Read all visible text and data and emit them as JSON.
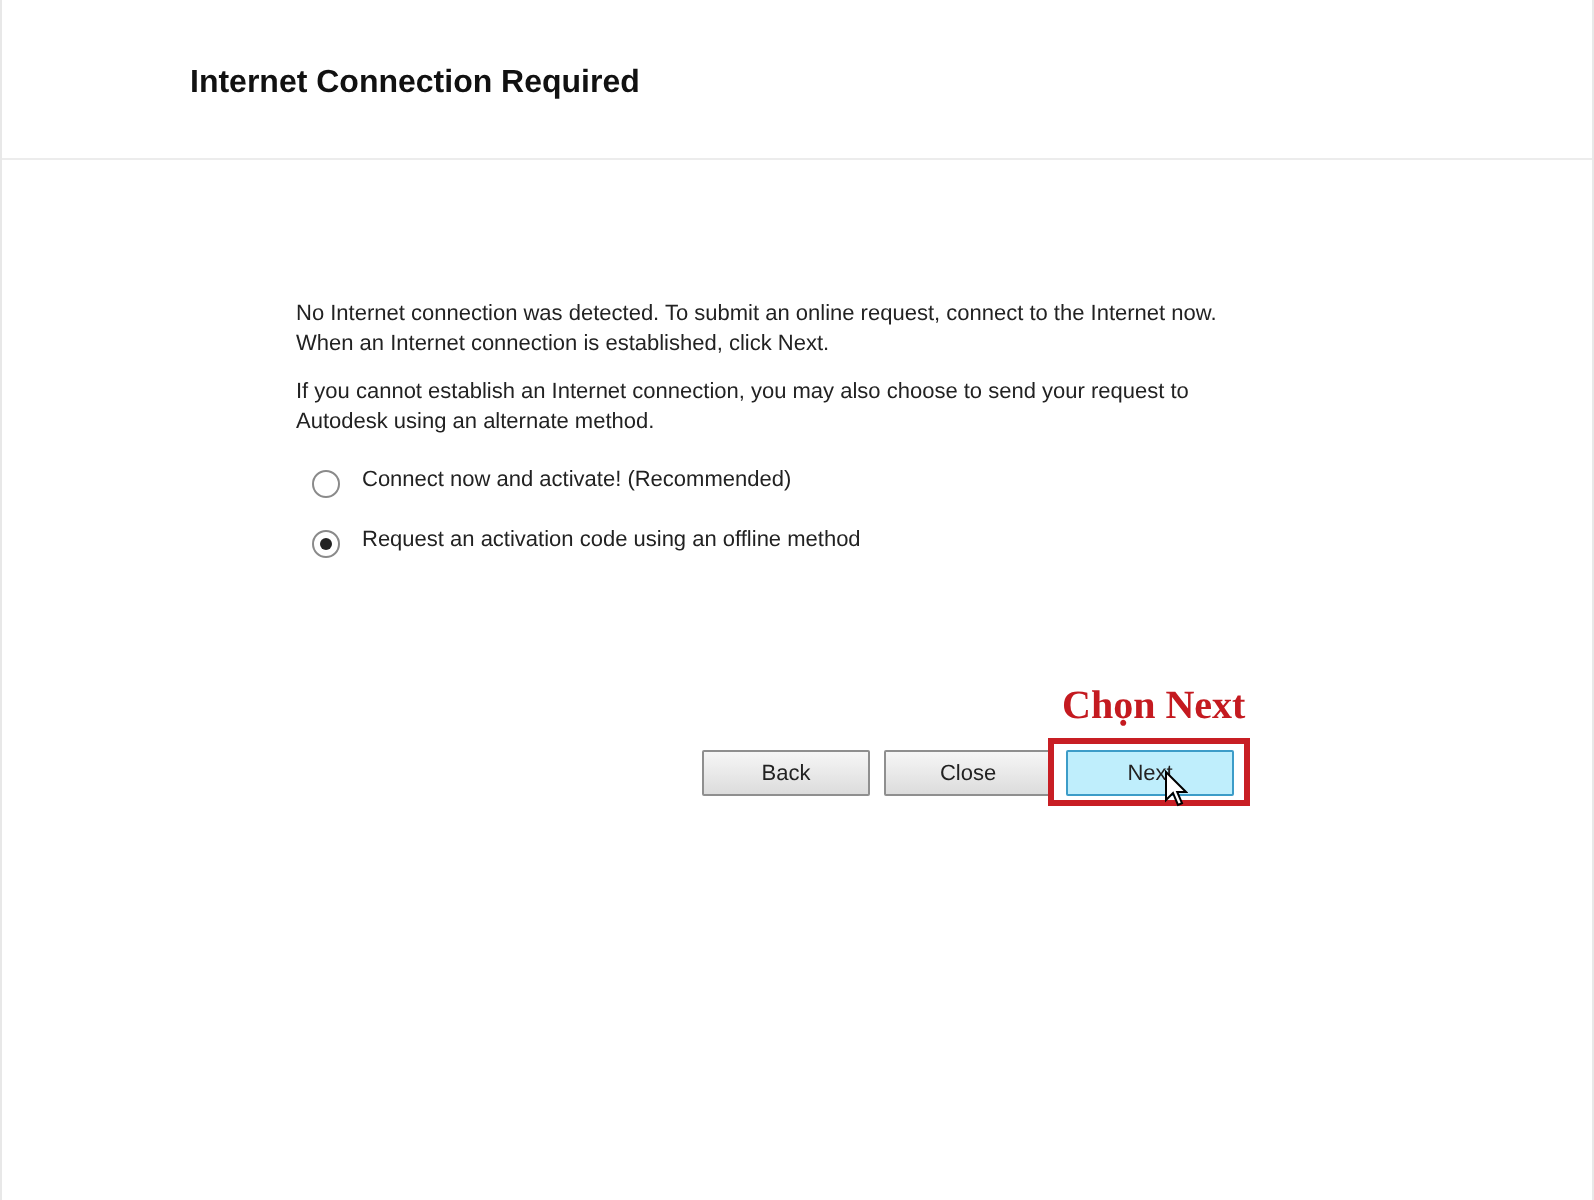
{
  "title": "Internet Connection Required",
  "paragraphs": [
    "No Internet connection was detected. To submit an online request, connect to the Internet now. When an Internet connection is established, click Next.",
    "If you cannot establish an Internet connection, you may also choose to send your request to Autodesk using an alternate method."
  ],
  "options": [
    {
      "label": "Connect now and activate! (Recommended)",
      "selected": false
    },
    {
      "label": "Request an activation code using an offline method",
      "selected": true
    }
  ],
  "buttons": [
    {
      "label": "Back",
      "focused": false
    },
    {
      "label": "Close",
      "focused": false
    },
    {
      "label": "Next",
      "focused": true
    }
  ],
  "annotation": {
    "label": "Chọn Next"
  }
}
